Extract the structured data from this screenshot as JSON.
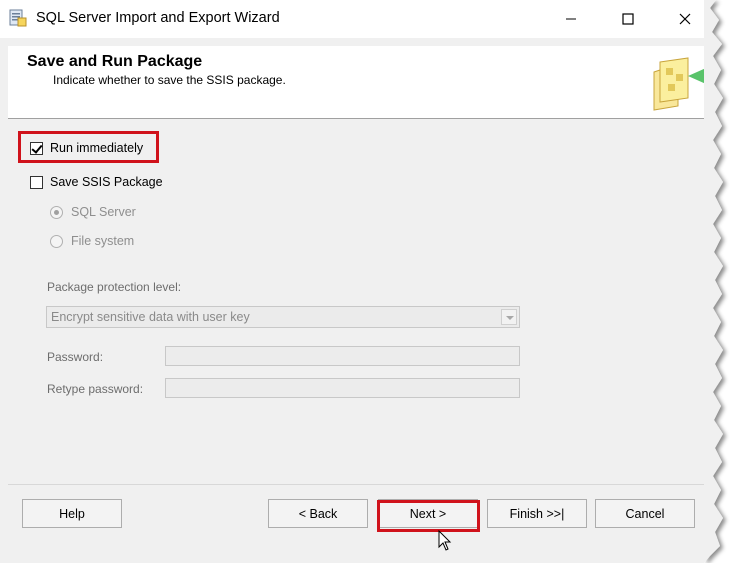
{
  "window": {
    "title": "SQL Server Import and Export Wizard",
    "minimize_icon": "minimize-icon",
    "maximize_icon": "maximize-icon",
    "close_icon": "close-icon"
  },
  "header": {
    "title": "Save and Run Package",
    "subtitle": "Indicate whether to save the SSIS package.",
    "icon": "package-wizard-icon"
  },
  "options": {
    "run_immediately": {
      "label": "Run immediately",
      "checked": true
    },
    "save_ssis_package": {
      "label": "Save SSIS Package",
      "checked": false
    },
    "sql_server": {
      "label": "SQL Server",
      "selected": true,
      "enabled": false
    },
    "file_system": {
      "label": "File system",
      "selected": false,
      "enabled": false
    }
  },
  "protection": {
    "label": "Package protection level:",
    "selected": "Encrypt sensitive data with user key"
  },
  "password": {
    "label": "Password:",
    "value": ""
  },
  "retype_password": {
    "label": "Retype password:",
    "value": ""
  },
  "buttons": {
    "help": "Help",
    "back": "< Back",
    "next": "Next >",
    "finish": "Finish >>|",
    "cancel": "Cancel"
  },
  "colors": {
    "highlight": "#d0121b",
    "window_bg": "#f0f0f0",
    "disabled_text": "#8e8e8e"
  }
}
